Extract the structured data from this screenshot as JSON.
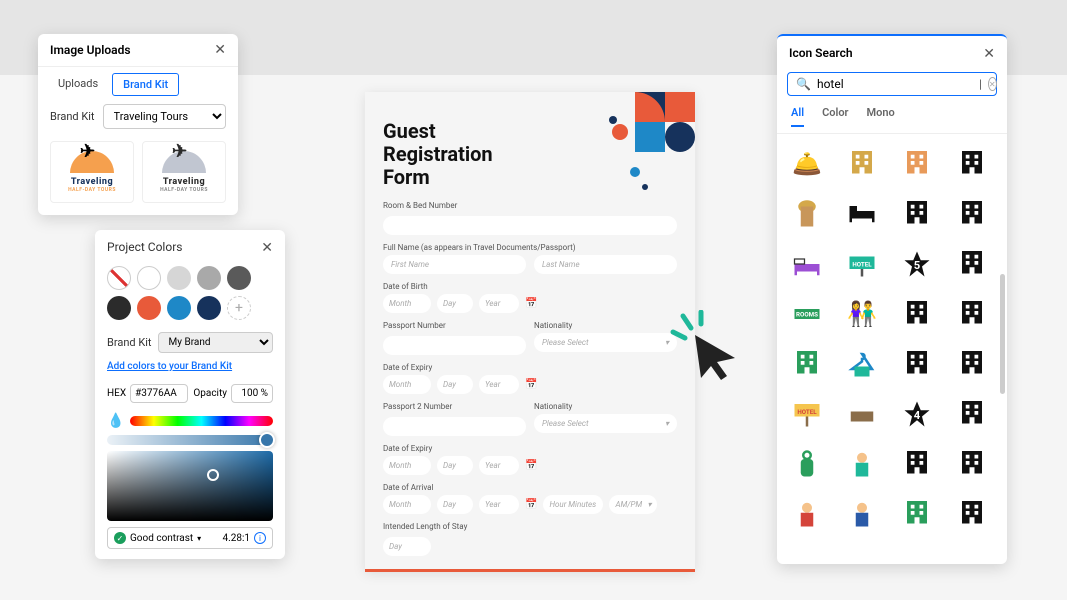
{
  "uploads": {
    "title": "Image Uploads",
    "tabs": [
      "Uploads",
      "Brand Kit"
    ],
    "active_tab": "Brand Kit",
    "brand_kit_label": "Brand Kit",
    "brand_kit_value": "Traveling Tours",
    "logo1": {
      "name": "Traveling",
      "sub": "HALF-DAY TOURS"
    },
    "logo2": {
      "name": "Traveling",
      "sub": "HALF-DAY TOURS"
    }
  },
  "colors": {
    "title": "Project Colors",
    "swatches": [
      "none",
      "#ffffff",
      "#d6d6d6",
      "#a9a9a9",
      "#5a5a5a",
      "#2b2b2b",
      "#e85a3a",
      "#1e88c7",
      "#16325c",
      "add"
    ],
    "brand_kit_label": "Brand Kit",
    "brand_kit_value": "My Brand",
    "link": "Add colors to your Brand Kit",
    "hex_label": "HEX",
    "hex_value": "#3776AA",
    "opacity_label": "Opacity",
    "opacity_value": "100 %",
    "contrast_label": "Good contrast",
    "contrast_ratio": "4.28:1"
  },
  "form": {
    "title_l1": "Guest",
    "title_l2": "Registration",
    "title_l3": "Form",
    "room_label": "Room & Bed Number",
    "fullname_label": "Full Name (as appears in Travel Documents/Passport)",
    "first_ph": "First Name",
    "last_ph": "Last Name",
    "dob_label": "Date of Birth",
    "month_ph": "Month",
    "day_ph": "Day",
    "year_ph": "Year",
    "passport_label": "Passport Number",
    "nationality_label": "Nationality",
    "please_select": "Please Select",
    "expiry_label": "Date of Expiry",
    "passport2_label": "Passport 2 Number",
    "arrival_label": "Date of Arrival",
    "hour_ph": "Hour Minutes",
    "ampm_ph": "AM/PM",
    "stay_label": "Intended Length of Stay"
  },
  "icons": {
    "title": "Icon Search",
    "search_value": "hotel",
    "tabs": [
      "All",
      "Color",
      "Mono"
    ],
    "active_tab": "All",
    "grid": [
      "bellhop-color",
      "hotel-building-color",
      "hotel-building-color-2",
      "hotel-mono",
      "door-color",
      "bed-mono",
      "hotel-mono-2",
      "hotel-mono-3",
      "bed-color",
      "hotel-sign-color",
      "star-5",
      "hotel-mono-4",
      "rooms-sign",
      "couple-color",
      "hotel-mono-5",
      "hotel-mono-6",
      "hotel-green",
      "hanger-color",
      "hotel-mono-7",
      "hotel-mono-8",
      "hotel-sign-yellow",
      "bed-color-2",
      "star-4",
      "hotel-mono-9",
      "do-not-disturb",
      "bellhop-green",
      "hotel-mono-10",
      "hotel-mono-11",
      "bellhop-red",
      "bellhop-blue",
      "hotel-green-2",
      "hotel-mono-12"
    ]
  }
}
